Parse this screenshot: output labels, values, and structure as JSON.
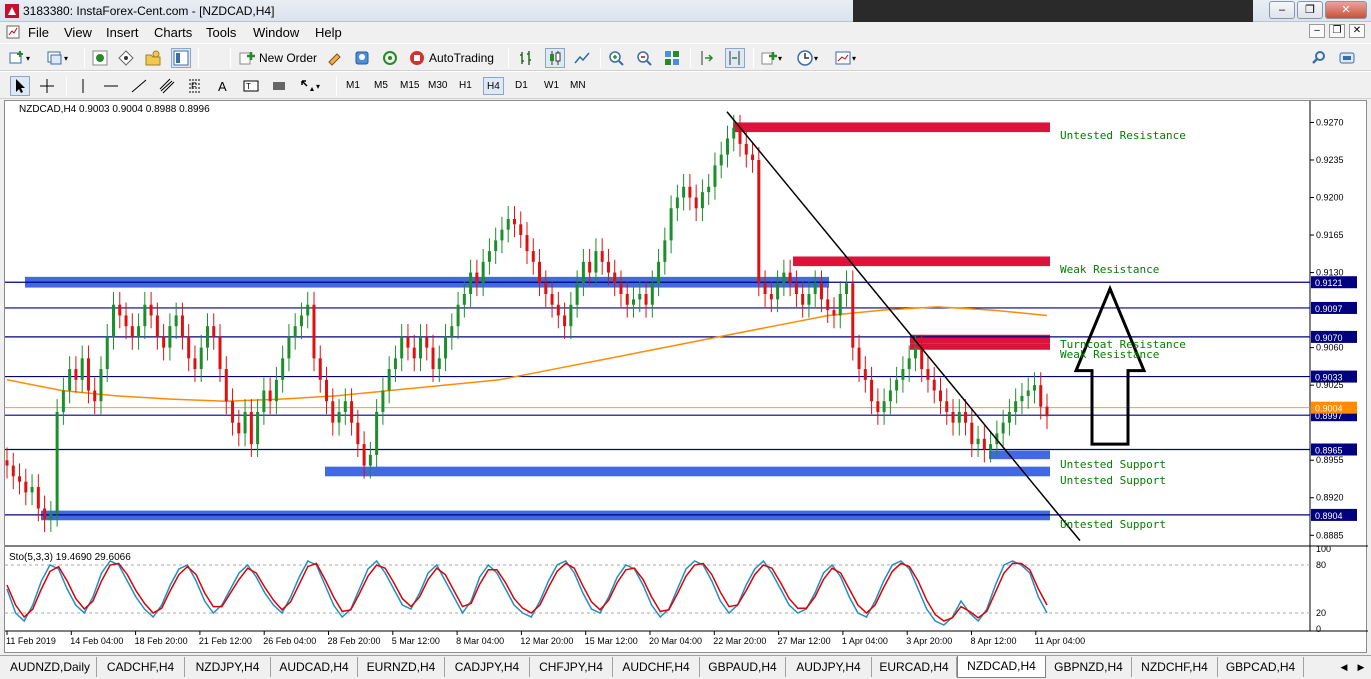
{
  "window": {
    "title": "3183380: InstaForex-Cent.com - [NZDCAD,H4]",
    "min": "–",
    "restore": "❐",
    "close": "✕"
  },
  "menu": [
    "File",
    "View",
    "Insert",
    "Charts",
    "Tools",
    "Window",
    "Help"
  ],
  "toolbar": {
    "new_order": "New Order",
    "autotrading": "AutoTrading"
  },
  "timeframes": [
    "M1",
    "M5",
    "M15",
    "M30",
    "H1",
    "H4",
    "D1",
    "W1",
    "MN"
  ],
  "active_timeframe": "H4",
  "chart": {
    "header": "NZDCAD,H4  0.9003 0.9004 0.8988 0.8996",
    "indicator_label": "Sto(5,3,3) 19.4690 29.6066",
    "price_labels": [
      "0.9270",
      "0.9235",
      "0.9200",
      "0.9165",
      "0.9130",
      "0.9060",
      "0.9025",
      "0.8955",
      "0.8920",
      "0.8885"
    ],
    "level_labels": [
      "0.9121",
      "0.9097",
      "0.9070",
      "0.9033",
      "0.8997",
      "0.8965",
      "0.8904"
    ],
    "bid_label": "0.9004",
    "stoch_labels": [
      "100",
      "80",
      "20",
      "0"
    ],
    "time_labels": [
      "11 Feb 2019",
      "14 Feb 04:00",
      "18 Feb 20:00",
      "21 Feb 12:00",
      "26 Feb 04:00",
      "28 Feb 20:00",
      "5 Mar 12:00",
      "8 Mar 04:00",
      "12 Mar 20:00",
      "15 Mar 12:00",
      "20 Mar 04:00",
      "22 Mar 20:00",
      "27 Mar 12:00",
      "1 Apr 04:00",
      "3 Apr 20:00",
      "8 Apr 12:00",
      "11 Apr 04:00"
    ],
    "zone_labels": [
      "Weak Resistance",
      "Untested Resistance",
      "Weak Resistance",
      "Turncoat Resistance",
      "Weak Resistance",
      "Untested Support",
      "Untested Support",
      "Untested Support"
    ],
    "colors": {
      "bull": "#1a8f2a",
      "bear": "#e01010",
      "resistance": "#dc143c",
      "support": "#4169e1",
      "hline": "#000080",
      "ma": "#ff8c00",
      "stoch_main": "#1e90c8",
      "stoch_signal": "#e00000"
    }
  },
  "chart_data": {
    "type": "candlestick",
    "symbol": "NZDCAD",
    "timeframe": "H4",
    "ylim": [
      0.8875,
      0.929
    ],
    "closes": [
      0.895,
      0.894,
      0.8935,
      0.8925,
      0.893,
      0.891,
      0.89,
      0.8905,
      0.9,
      0.902,
      0.904,
      0.903,
      0.905,
      0.902,
      0.901,
      0.904,
      0.907,
      0.91,
      0.909,
      0.908,
      0.907,
      0.908,
      0.91,
      0.909,
      0.907,
      0.906,
      0.908,
      0.909,
      0.907,
      0.905,
      0.904,
      0.906,
      0.908,
      0.907,
      0.904,
      0.901,
      0.899,
      0.898,
      0.9,
      0.897,
      0.9,
      0.902,
      0.901,
      0.903,
      0.905,
      0.907,
      0.908,
      0.909,
      0.91,
      0.905,
      0.903,
      0.901,
      0.899,
      0.9,
      0.901,
      0.899,
      0.897,
      0.895,
      0.896,
      0.9,
      0.902,
      0.904,
      0.905,
      0.907,
      0.906,
      0.905,
      0.907,
      0.906,
      0.904,
      0.905,
      0.907,
      0.908,
      0.91,
      0.911,
      0.913,
      0.912,
      0.914,
      0.915,
      0.916,
      0.917,
      0.918,
      0.9175,
      0.9165,
      0.915,
      0.914,
      0.912,
      0.911,
      0.91,
      0.909,
      0.908,
      0.91,
      0.912,
      0.914,
      0.913,
      0.915,
      0.914,
      0.913,
      0.912,
      0.911,
      0.91,
      0.9105,
      0.911,
      0.91,
      0.912,
      0.914,
      0.916,
      0.919,
      0.92,
      0.921,
      0.92,
      0.919,
      0.9205,
      0.921,
      0.923,
      0.924,
      0.9255,
      0.9265,
      0.925,
      0.924,
      0.9235,
      0.912,
      0.911,
      0.9105,
      0.912,
      0.913,
      0.912,
      0.911,
      0.91,
      0.911,
      0.912,
      0.9105,
      0.9095,
      0.909,
      0.911,
      0.912,
      0.906,
      0.904,
      0.903,
      0.901,
      0.9,
      0.901,
      0.902,
      0.903,
      0.904,
      0.905,
      0.906,
      0.904,
      0.903,
      0.902,
      0.901,
      0.9,
      0.899,
      0.9,
      0.899,
      0.897,
      0.8975,
      0.8965,
      0.897,
      0.898,
      0.899,
      0.9,
      0.901,
      0.9015,
      0.902,
      0.9025,
      0.9005,
      0.8996
    ],
    "horizontal_levels": [
      0.9121,
      0.9097,
      0.907,
      0.9033,
      0.8997,
      0.8965,
      0.8904
    ],
    "bid": 0.9004,
    "moving_average": [
      0.903,
      0.902,
      0.9015,
      0.9012,
      0.901,
      0.9012,
      0.9015,
      0.902,
      0.9025,
      0.903,
      0.904,
      0.905,
      0.906,
      0.907,
      0.908,
      0.909,
      0.9095,
      0.9098,
      0.9095,
      0.909
    ],
    "zones": [
      {
        "kind": "resistance",
        "label": "Untested Resistance",
        "low": 0.9261,
        "high": 0.927
      },
      {
        "kind": "resistance",
        "label": "Weak Resistance",
        "low": 0.9136,
        "high": 0.9145
      },
      {
        "kind": "resistance",
        "label": "Turncoat Resistance",
        "low": 0.9064,
        "high": 0.9072
      },
      {
        "kind": "resistance",
        "label": "Weak Resistance",
        "low": 0.9058,
        "high": 0.9064
      },
      {
        "kind": "support",
        "label": "Untested Support",
        "low": 0.8956,
        "high": 0.8964
      },
      {
        "kind": "support",
        "label": "Untested Support",
        "low": 0.894,
        "high": 0.8949
      },
      {
        "kind": "support",
        "label": "Untested Support",
        "low": 0.8899,
        "high": 0.8908
      },
      {
        "kind": "support",
        "label": "",
        "low": 0.9116,
        "high": 0.9126
      }
    ],
    "trendline": {
      "start_price": 0.928,
      "end_price": 0.888
    },
    "arrow": {
      "direction": "up",
      "from_price": 0.897,
      "to_price": 0.9115
    },
    "stochastic": {
      "params": "5,3,3",
      "main": 19.469,
      "signal": 29.6066,
      "ylim": [
        0,
        100
      ],
      "levels": [
        80,
        20
      ],
      "main_series": [
        50,
        20,
        10,
        30,
        60,
        80,
        75,
        50,
        30,
        20,
        40,
        70,
        85,
        80,
        60,
        40,
        25,
        15,
        30,
        55,
        75,
        80,
        60,
        35,
        20,
        30,
        50,
        70,
        80,
        65,
        45,
        30,
        20,
        40,
        65,
        85,
        80,
        55,
        30,
        15,
        25,
        50,
        75,
        85,
        70,
        50,
        30,
        25,
        45,
        70,
        80,
        60,
        40,
        20,
        35,
        65,
        80,
        70,
        50,
        30,
        20,
        15,
        35,
        60,
        80,
        85,
        70,
        45,
        25,
        20,
        40,
        65,
        80,
        75,
        55,
        30,
        15,
        25,
        50,
        75,
        85,
        80,
        60,
        35,
        20,
        30,
        55,
        75,
        85,
        70,
        50,
        30,
        20,
        25,
        45,
        70,
        80,
        65,
        40,
        20,
        15,
        35,
        60,
        80,
        85,
        75,
        50,
        25,
        10,
        5,
        15,
        35,
        20,
        10,
        25,
        55,
        80,
        85,
        80,
        70,
        40,
        20
      ],
      "signal_series": [
        55,
        30,
        15,
        25,
        50,
        72,
        78,
        60,
        38,
        25,
        35,
        60,
        80,
        82,
        68,
        48,
        32,
        20,
        26,
        48,
        68,
        78,
        68,
        45,
        28,
        28,
        45,
        62,
        76,
        70,
        52,
        36,
        24,
        34,
        56,
        78,
        82,
        62,
        40,
        22,
        24,
        44,
        66,
        80,
        76,
        58,
        38,
        28,
        40,
        62,
        76,
        68,
        48,
        28,
        32,
        56,
        74,
        74,
        58,
        38,
        26,
        20,
        30,
        52,
        72,
        82,
        76,
        54,
        34,
        24,
        36,
        58,
        74,
        76,
        62,
        40,
        22,
        24,
        44,
        66,
        80,
        82,
        68,
        46,
        28,
        30,
        48,
        68,
        80,
        76,
        58,
        38,
        26,
        26,
        40,
        62,
        76,
        70,
        50,
        30,
        20,
        30,
        52,
        72,
        82,
        78,
        60,
        36,
        18,
        10,
        14,
        28,
        22,
        14,
        22,
        46,
        70,
        82,
        82,
        74,
        50,
        30
      ]
    },
    "time_labels": [
      "11 Feb 2019",
      "14 Feb 04:00",
      "18 Feb 20:00",
      "21 Feb 12:00",
      "26 Feb 04:00",
      "28 Feb 20:00",
      "5 Mar 12:00",
      "8 Mar 04:00",
      "12 Mar 20:00",
      "15 Mar 12:00",
      "20 Mar 04:00",
      "22 Mar 20:00",
      "27 Mar 12:00",
      "1 Apr 04:00",
      "3 Apr 20:00",
      "8 Apr 12:00",
      "11 Apr 04:00"
    ]
  },
  "tabs": [
    "AUDNZD,Daily",
    "CADCHF,H4",
    "NZDJPY,H4",
    "AUDCAD,H4",
    "EURNZD,H4",
    "CADJPY,H4",
    "CHFJPY,H4",
    "AUDCHF,H4",
    "GBPAUD,H4",
    "AUDJPY,H4",
    "EURCAD,H4",
    "NZDCAD,H4",
    "GBPNZD,H4",
    "NZDCHF,H4",
    "GBPCAD,H4"
  ],
  "active_tab": "NZDCAD,H4",
  "icons": [
    "app-icon",
    "new-chart-icon",
    "profiles-icon",
    "market-watch-icon",
    "data-window-icon",
    "navigator-icon",
    "terminal-icon",
    "new-order-icon",
    "metaeditor-icon",
    "autotrading-icon",
    "bar-chart-icon",
    "candlestick-icon",
    "line-chart-icon",
    "zoom-in-icon",
    "zoom-out-icon",
    "tile-windows-icon",
    "chart-shift-icon",
    "autoscroll-icon",
    "indicators-icon",
    "periods-icon",
    "templates-icon",
    "search-icon",
    "account-icon",
    "cursor-icon",
    "crosshair-icon",
    "vertical-line-icon",
    "horizontal-line-icon",
    "trendline-icon",
    "channel-icon",
    "fibonacci-icon",
    "text-icon",
    "label-icon",
    "rectangle-icon",
    "arrows-icon"
  ]
}
